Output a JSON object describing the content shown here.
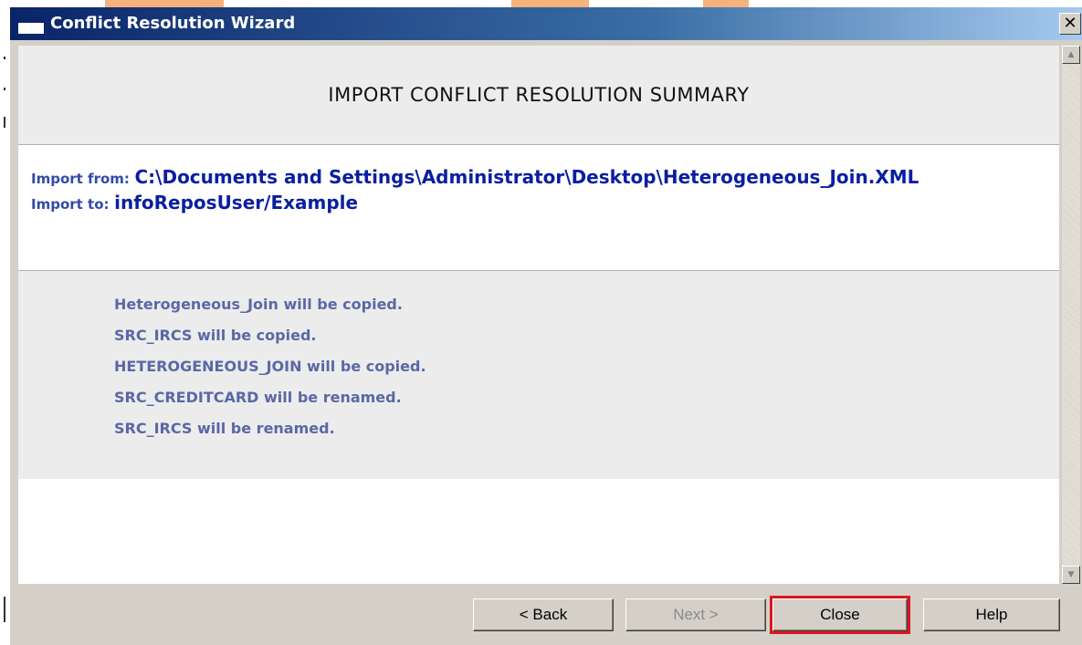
{
  "window": {
    "title": "Conflict Resolution Wizard",
    "close_glyph": "✕"
  },
  "summary": {
    "heading": "IMPORT CONFLICT RESOLUTION SUMMARY",
    "import_from_label": "Import from:",
    "import_from_value": "C:\\Documents and Settings\\Administrator\\Desktop\\Heterogeneous_Join.XML",
    "import_to_label": "Import to:",
    "import_to_value": "infoReposUser/Example"
  },
  "results": [
    "Heterogeneous_Join will be copied.",
    "SRC_IRCS will be copied.",
    "HETEROGENEOUS_JOIN will be copied.",
    "SRC_CREDITCARD will be renamed.",
    "SRC_IRCS will be renamed."
  ],
  "buttons": {
    "back": "< Back",
    "next": "Next >",
    "close": "Close",
    "help": "Help"
  },
  "scrollbar": {
    "up_glyph": "▲",
    "down_glyph": "▼"
  },
  "colors": {
    "accent_orange": "#f7b27c",
    "title_bar": "#0a246a",
    "path_text": "#0a1fa0",
    "result_text": "#5a68a6",
    "focus_outline": "#e0141c"
  }
}
